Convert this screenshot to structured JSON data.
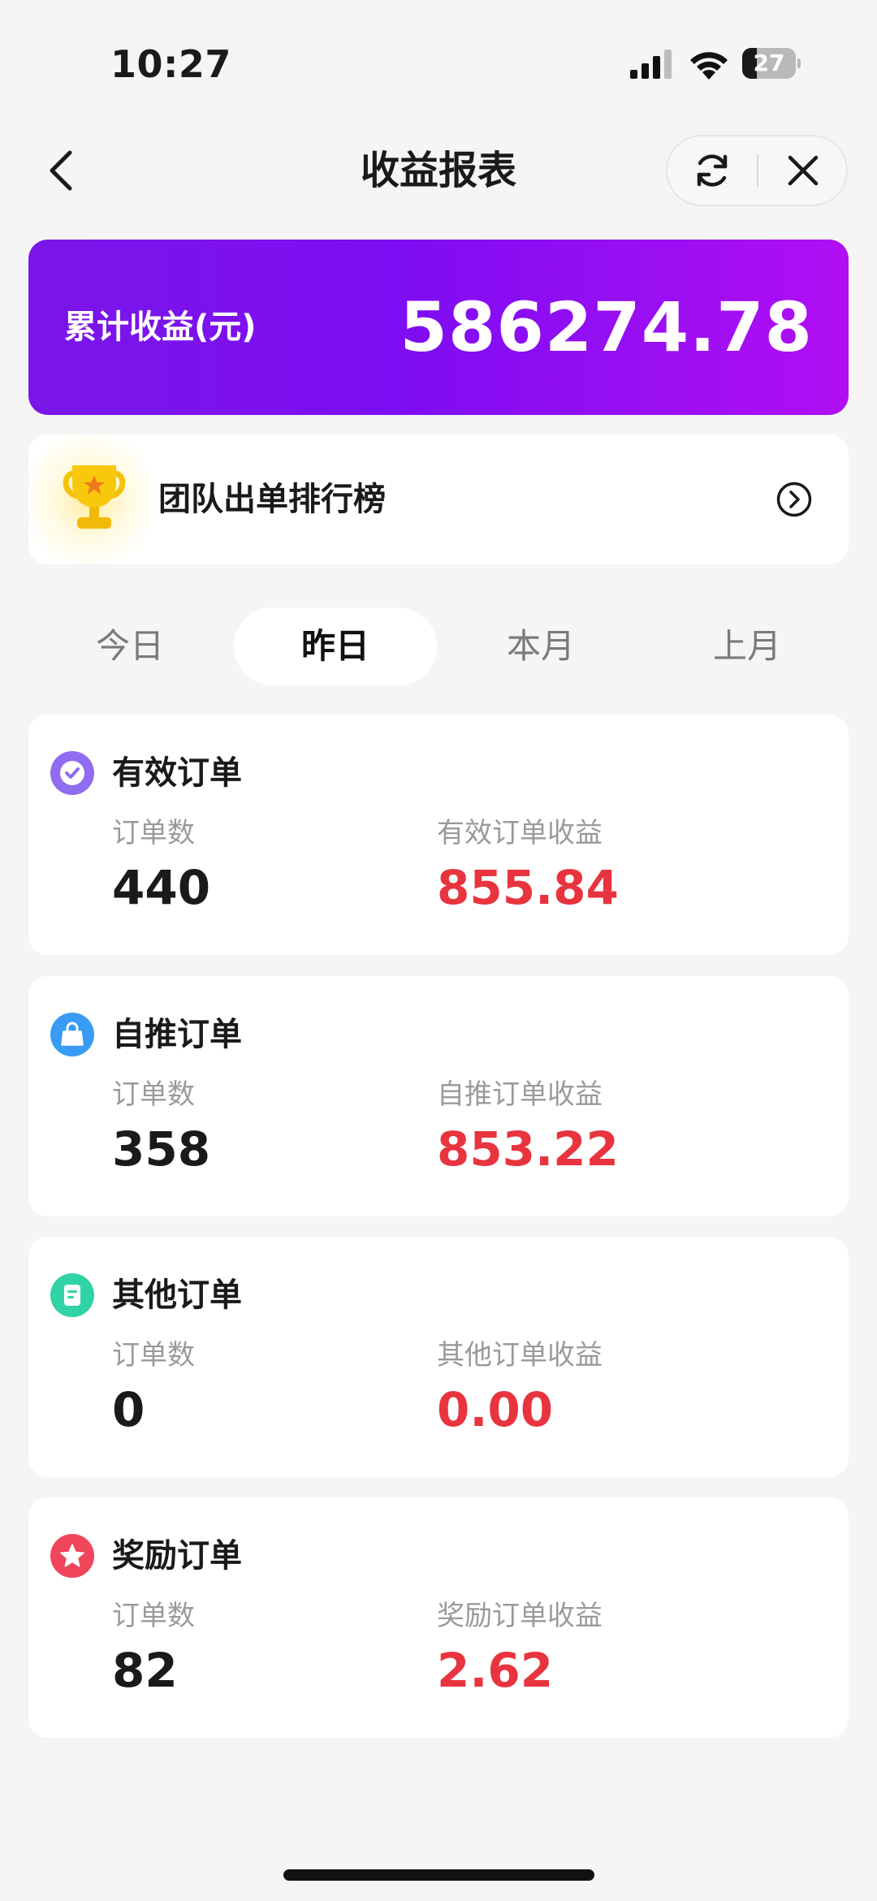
{
  "status_bar": {
    "time": "10:27",
    "battery_level": 27,
    "battery_text": "27",
    "icons": [
      "signal-icon",
      "wifi-icon",
      "battery-icon"
    ]
  },
  "nav": {
    "title": "收益报表",
    "icons": [
      "back-icon",
      "refresh-icon",
      "close-icon"
    ]
  },
  "banner": {
    "label": "累计收益(元)",
    "value": "586274.78",
    "gradient": [
      "#7a16e8",
      "#b10ef3"
    ]
  },
  "ranking": {
    "label": "团队出单排行榜",
    "icons": [
      "trophy-icon",
      "chevron-right-circle-icon"
    ]
  },
  "tabs": [
    {
      "label": "今日",
      "active": false
    },
    {
      "label": "昨日",
      "active": true
    },
    {
      "label": "本月",
      "active": false
    },
    {
      "label": "上月",
      "active": false
    }
  ],
  "cards": [
    {
      "title": "有效订单",
      "icon": "check-badge-icon",
      "icon_color": "#8f6cf0",
      "count_label": "订单数",
      "count": "440",
      "earn_label": "有效订单收益",
      "earn": "855.84"
    },
    {
      "title": "自推订单",
      "icon": "shopping-bag-icon",
      "icon_color": "#3a9bf4",
      "count_label": "订单数",
      "count": "358",
      "earn_label": "自推订单收益",
      "earn": "853.22"
    },
    {
      "title": "其他订单",
      "icon": "document-icon",
      "icon_color": "#2fd3a6",
      "count_label": "订单数",
      "count": "0",
      "earn_label": "其他订单收益",
      "earn": "0.00"
    },
    {
      "title": "奖励订单",
      "icon": "star-badge-icon",
      "icon_color": "#f0455a",
      "count_label": "订单数",
      "count": "82",
      "earn_label": "奖励订单收益",
      "earn": "2.62"
    }
  ],
  "colors": {
    "earn_value": "#e8343f",
    "background": "#f5f5f5"
  }
}
